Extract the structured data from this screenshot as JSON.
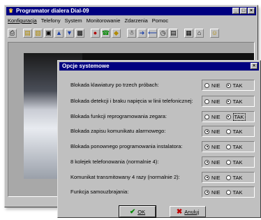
{
  "window": {
    "title": "Programator dialera Dial-09"
  },
  "menu": [
    "Konfiguracja",
    "Telefony",
    "System",
    "Monitorowanie",
    "Zdarzenia",
    "Pomoc"
  ],
  "dialog": {
    "title": "Opcje systemowe",
    "options": [
      {
        "label": "Blokada klawiatury po trzech próbach:",
        "selected": "TAK"
      },
      {
        "label": "Blokada detekcji i braku napięcia w linii telefonicznej:",
        "selected": "TAK"
      },
      {
        "label": "Blokada funkcji reprogramowania zegara:",
        "selected": "TAK"
      },
      {
        "label": "Blokada zapisu komunikatu alarmowego:",
        "selected": "NIE"
      },
      {
        "label": "Blokada ponownego programowania instalatora:",
        "selected": "NIE"
      },
      {
        "label": "8 kolejek telefonowania (normalnie 4):",
        "selected": "NIE"
      },
      {
        "label": "Komunikat transmitowany 4 razy (normalnie 2):",
        "selected": "NIE"
      },
      {
        "label": "Funkcja samouzbrajania:",
        "selected": "NIE"
      }
    ],
    "nie_label": "NIE",
    "tak_label": "TAK",
    "ok_label": "OK",
    "cancel_label": "Anuluj"
  }
}
